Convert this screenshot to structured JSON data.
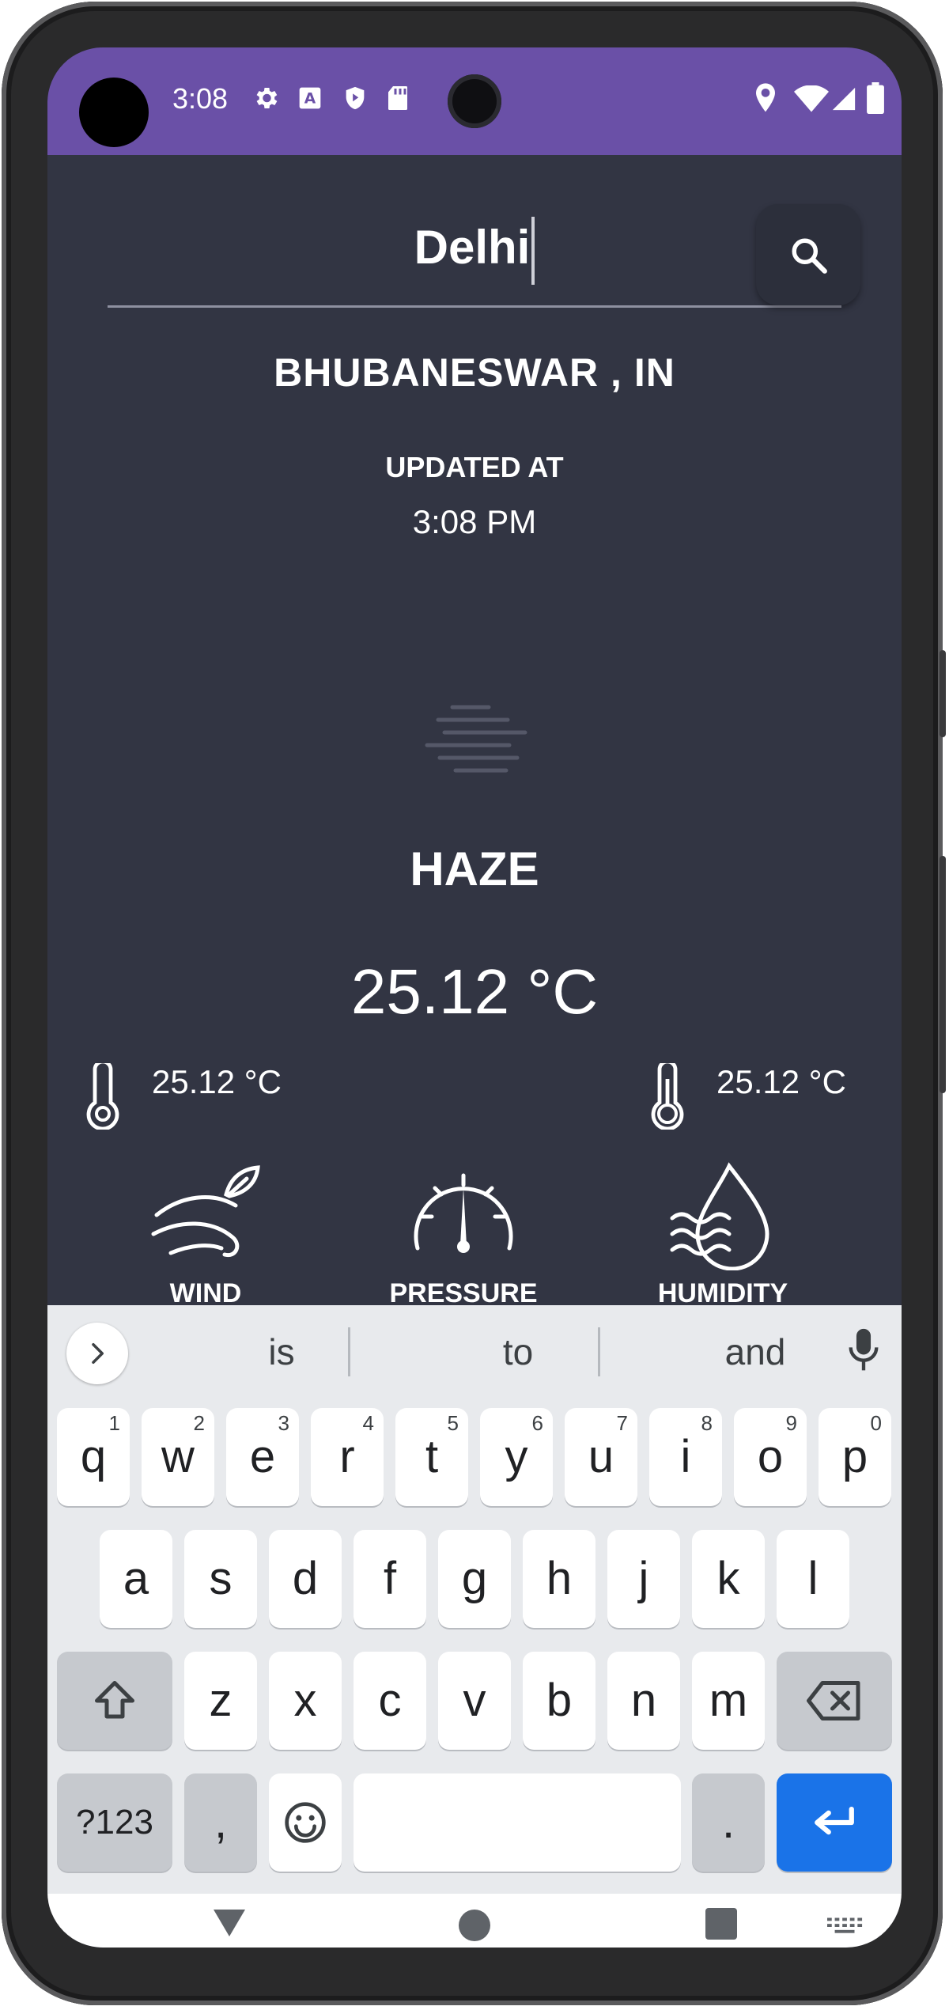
{
  "status_bar": {
    "time": "3:08",
    "left_icons": [
      "settings-icon",
      "font-a-icon",
      "shield-play-icon",
      "sd-card-icon"
    ],
    "right_icons": [
      "location-icon",
      "wifi-icon",
      "signal-icon",
      "battery-icon"
    ],
    "background_color": "#6a50a7"
  },
  "search": {
    "value": "Delhi",
    "button_icon": "search-icon"
  },
  "weather": {
    "location": "BHUBANESWAR , IN",
    "updated_label": "UPDATED AT",
    "updated_time": "3:08 PM",
    "condition_icon": "haze-icon",
    "condition": "HAZE",
    "temperature": "25.12 °C",
    "min_temp": "25.12 °C",
    "max_temp": "25.12 °C",
    "stats": [
      {
        "label": "WIND",
        "icon": "wind-icon"
      },
      {
        "label": "PRESSURE",
        "icon": "gauge-icon"
      },
      {
        "label": "HUMIDITY",
        "icon": "humidity-icon"
      }
    ],
    "background_color": "#323543"
  },
  "keyboard": {
    "suggestions": [
      "is",
      "to",
      "and"
    ],
    "row1": [
      {
        "key": "q",
        "hint": "1"
      },
      {
        "key": "w",
        "hint": "2"
      },
      {
        "key": "e",
        "hint": "3"
      },
      {
        "key": "r",
        "hint": "4"
      },
      {
        "key": "t",
        "hint": "5"
      },
      {
        "key": "y",
        "hint": "6"
      },
      {
        "key": "u",
        "hint": "7"
      },
      {
        "key": "i",
        "hint": "8"
      },
      {
        "key": "o",
        "hint": "9"
      },
      {
        "key": "p",
        "hint": "0"
      }
    ],
    "row2": [
      "a",
      "s",
      "d",
      "f",
      "g",
      "h",
      "j",
      "k",
      "l"
    ],
    "row3": [
      "z",
      "x",
      "c",
      "v",
      "b",
      "n",
      "m"
    ],
    "symbols_key": "?123",
    "comma_key": ",",
    "period_key": ".",
    "enter_color": "#1a73e8"
  },
  "nav_bar": {
    "buttons": [
      "back-icon",
      "home-icon",
      "recents-icon",
      "keyboard-switch-icon"
    ]
  }
}
